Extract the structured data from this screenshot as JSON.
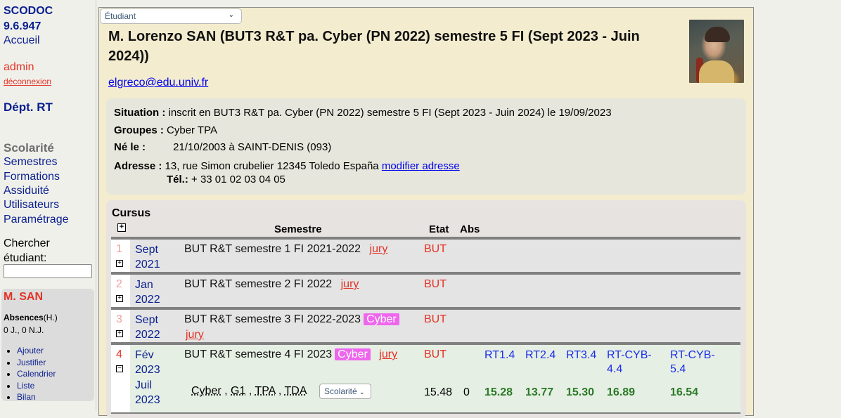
{
  "sidebar": {
    "app_name": "SCODOC",
    "version": "9.6.947",
    "home": "Accueil",
    "user": "admin",
    "logout": "déconnexion",
    "dept": "Dépt. RT",
    "section_title": "Scolarité",
    "nav": [
      "Semestres",
      "Formations",
      "Assiduité",
      "Utilisateurs",
      "Paramétrage"
    ],
    "search_label": "Chercher étudiant:",
    "search_value": "",
    "student": {
      "name": "M. SAN",
      "absences_label": "Absences",
      "absences_unit": "(H.)",
      "absences_value": "0 J., 0 N.J.",
      "actions": [
        "Ajouter",
        "Justifier",
        "Calendrier",
        "Liste",
        "Bilan"
      ]
    }
  },
  "main": {
    "view_select": "Étudiant",
    "title": "M. Lorenzo SAN (BUT3 R&T pa. Cyber (PN 2022) semestre 5 FI (Sept 2023 - Juin 2024))",
    "email": "elgreco@edu.univ.fr",
    "photo_icon": "student-photo",
    "info": {
      "situation_label": "Situation :",
      "situation": "inscrit en BUT3 R&T pa. Cyber (PN 2022) semestre 5 FI (Sept 2023 - Juin 2024) le 19/09/2023",
      "groupes_label": "Groupes :",
      "groupes": "Cyber TPA",
      "ne_label": "Né le :",
      "ne": "21/10/2003 à SAINT-DENIS (093)",
      "adresse_label": "Adresse :",
      "adresse": "13, rue Simon crubelier 12345 Toledo España",
      "modifier_adresse": "modifier adresse",
      "tel_label": "Tél.:",
      "tel": "+ 33 01 02 03 04 05"
    },
    "cursus": {
      "title": "Cursus",
      "headers": {
        "semestre": "Semestre",
        "etat": "Etat",
        "abs": "Abs"
      },
      "rows": [
        {
          "num": "1",
          "date1": "Sept",
          "date2": "2021",
          "title": "BUT R&T semestre 1 FI 2021-2022",
          "tag": "",
          "jury": "jury",
          "etat": "BUT",
          "expanded": false
        },
        {
          "num": "2",
          "date1": "Jan",
          "date2": "2022",
          "title": "BUT R&T semestre 2 FI 2022",
          "tag": "",
          "jury": "jury",
          "etat": "BUT",
          "expanded": false
        },
        {
          "num": "3",
          "date1": "Sept",
          "date2": "2022",
          "title": "BUT R&T semestre 3 FI 2022-2023",
          "tag": "Cyber",
          "jury": "jury",
          "etat": "BUT",
          "expanded": false
        },
        {
          "num": "4",
          "date1": "Fév",
          "date2": "2023",
          "title": "BUT R&T semestre 4 FI 2023",
          "tag": "Cyber",
          "jury": "jury",
          "etat": "BUT",
          "expanded": true,
          "end_date1": "Juil",
          "end_date2": "2023",
          "groups": [
            "Cyber",
            "G1",
            "TPA",
            "TDA"
          ],
          "scolarite_button": "Scolarité",
          "moyenne": "15.48",
          "abs": "0",
          "ues": [
            {
              "code": "RT1.4",
              "value": "15.28"
            },
            {
              "code": "RT2.4",
              "value": "13.77"
            },
            {
              "code": "RT3.4",
              "value": "15.30"
            },
            {
              "code": "RT-CYB-4.4",
              "value": "16.89"
            },
            {
              "code": "RT-CYB-5.4",
              "value": "16.54"
            }
          ]
        }
      ]
    }
  },
  "colors": {
    "brand_blue": "#0a1f8f",
    "red": "#e53226",
    "panel_bg": "#f3ecce",
    "cyber_tag": "#ee66ee",
    "ue_green": "#2a7a26"
  }
}
